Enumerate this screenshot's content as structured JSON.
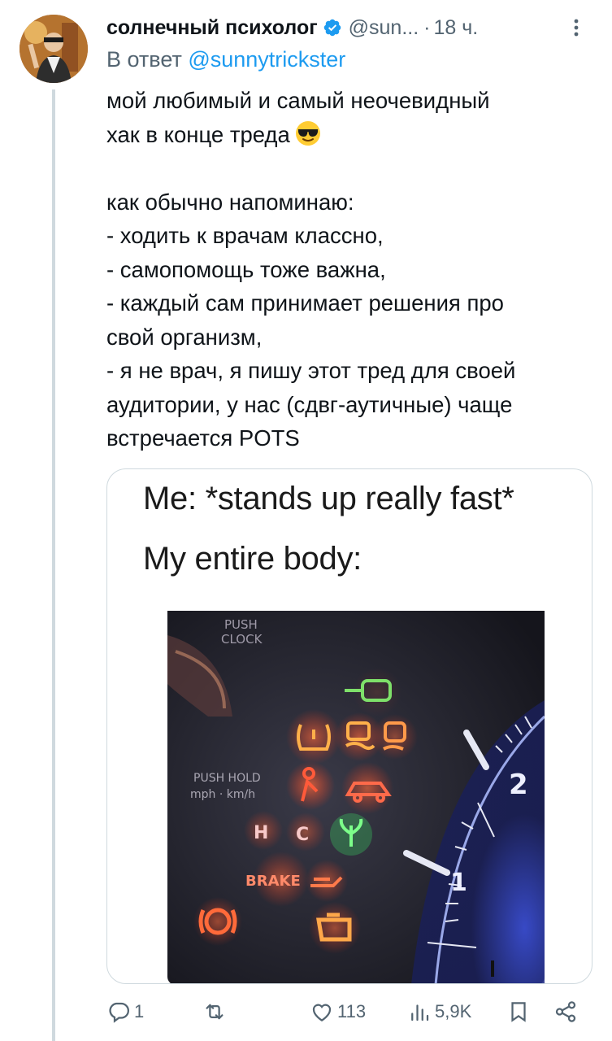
{
  "tweet": {
    "author": {
      "display_name": "солнечный психолог",
      "handle": "@sun...",
      "verified": true
    },
    "separator": "·",
    "time": "18 ч.",
    "reply": {
      "prefix": "В ответ",
      "mention": "@sunnytrickster"
    },
    "text_lines": [
      "мой любимый и самый неочевидный",
      "хак в конце треда",
      "",
      "как обычно напоминаю:",
      "- ходить к врачам классно,",
      "- самопомощь тоже важна,",
      "- каждый сам принимает решения про",
      "свой организм,",
      "- я не врач, я пишу этот тред для своей",
      "аудитории, у нас (сдвг-аутичные) чаще",
      "встречается POTS"
    ],
    "emoji": "smiling-face-with-sunglasses",
    "media": {
      "caption_line1": "Me: *stands up really fast*",
      "caption_line2": "My entire body:",
      "dashboard_labels": {
        "push_clock_1": "PUSH",
        "push_clock_2": "CLOCK",
        "push_hold": "PUSH HOLD",
        "units": "mph · km/h",
        "brake": "BRAKE",
        "gauge_2": "2",
        "gauge_1": "1"
      }
    },
    "actions": {
      "replies": "1",
      "reposts": "",
      "likes": "113",
      "views": "5,9K"
    }
  },
  "colors": {
    "text": "#0f1419",
    "secondary": "#536471",
    "accent": "#1d9bf0",
    "border": "#cfd9de"
  }
}
